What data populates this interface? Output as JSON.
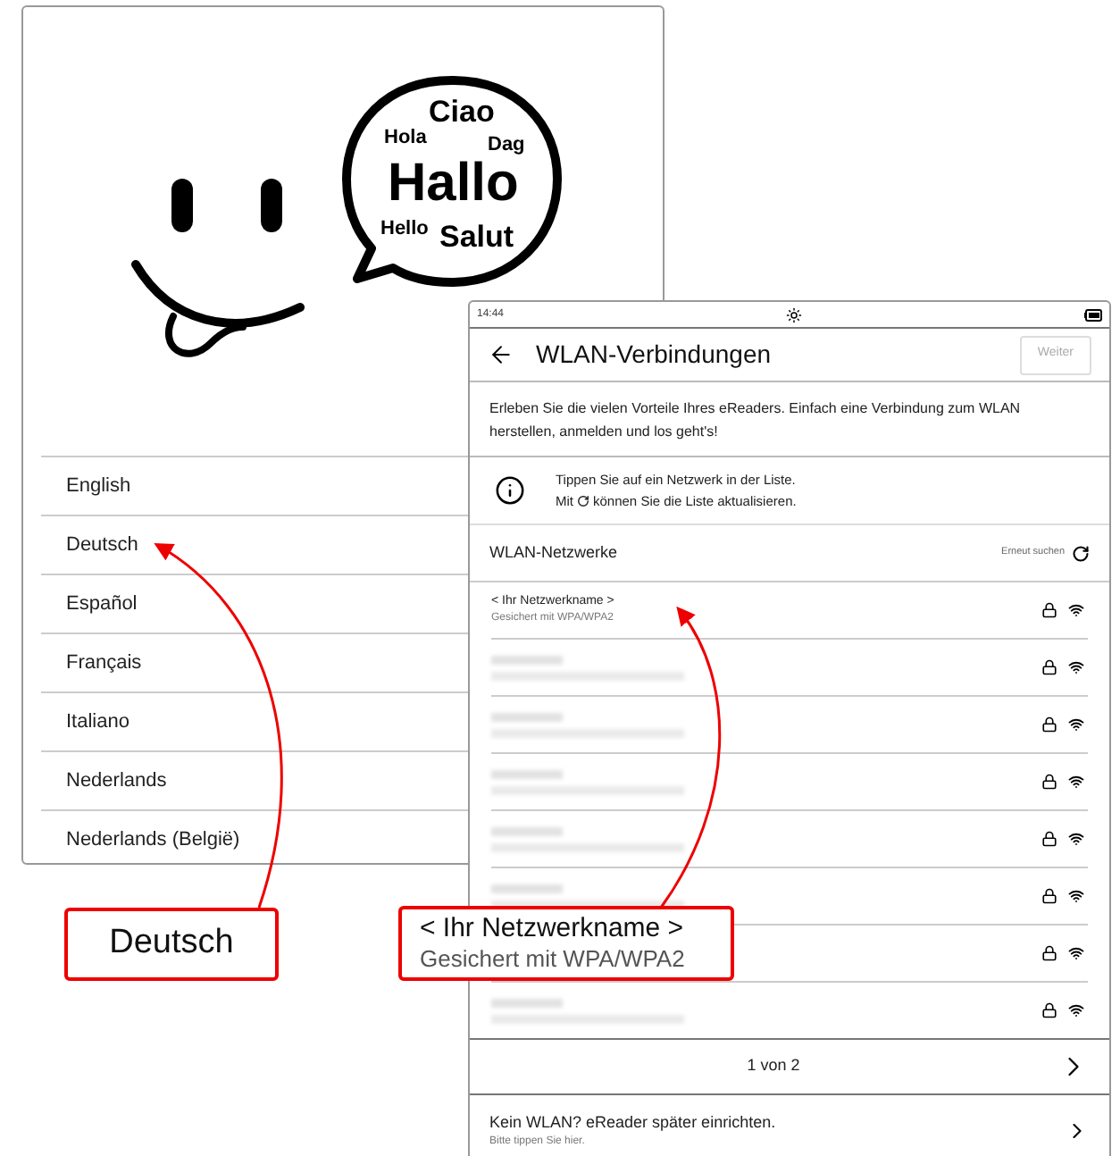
{
  "welcome_screen": {
    "bubble_words": [
      {
        "text": "Ciao",
        "kind": "medium"
      },
      {
        "text": "Hola",
        "kind": "small"
      },
      {
        "text": "Dag",
        "kind": "small"
      },
      {
        "text": "Hallo",
        "kind": "large"
      },
      {
        "text": "Hello",
        "kind": "small"
      },
      {
        "text": "Salut",
        "kind": "medium"
      }
    ],
    "languages": [
      "English",
      "Deutsch",
      "Español",
      "Français",
      "Italiano",
      "Nederlands",
      "Nederlands (België)"
    ]
  },
  "wifi_screen": {
    "status_bar": {
      "time": "14:44"
    },
    "header": {
      "title": "WLAN-Verbindungen",
      "next_button": {
        "label": "Weiter",
        "disabled": true
      }
    },
    "intro": "Erleben Sie die vielen Vorteile Ihres eReaders. Einfach eine Verbindung zum WLAN herstellen, anmelden und los geht's!",
    "hint": {
      "line_1": "Tippen Sie auf ein Netzwerk in der Liste.",
      "line_2_before": "Mit",
      "line_2_after": "können Sie die Liste aktualisieren."
    },
    "section": {
      "title": "WLAN-Netzwerke",
      "refresh_label": "Erneut suchen"
    },
    "networks": [
      {
        "kind": "visible",
        "name": "< Ihr Netzwerkname >",
        "security": "Gesichert mit WPA/WPA2"
      },
      {
        "kind": "blurred"
      },
      {
        "kind": "blurred"
      },
      {
        "kind": "blurred"
      },
      {
        "kind": "blurred"
      },
      {
        "kind": "blurred"
      },
      {
        "kind": "blurred"
      },
      {
        "kind": "blurred"
      }
    ],
    "pagination": "1 von 2",
    "footer": {
      "title": "Kein WLAN? eReader später einrichten.",
      "subtitle": "Bitte tippen Sie hier."
    }
  },
  "callouts": [
    {
      "line_1": "Deutsch"
    },
    {
      "line_1": "< Ihr Netzwerkname >",
      "line_2": "Gesichert mit WPA/WPA2"
    }
  ]
}
